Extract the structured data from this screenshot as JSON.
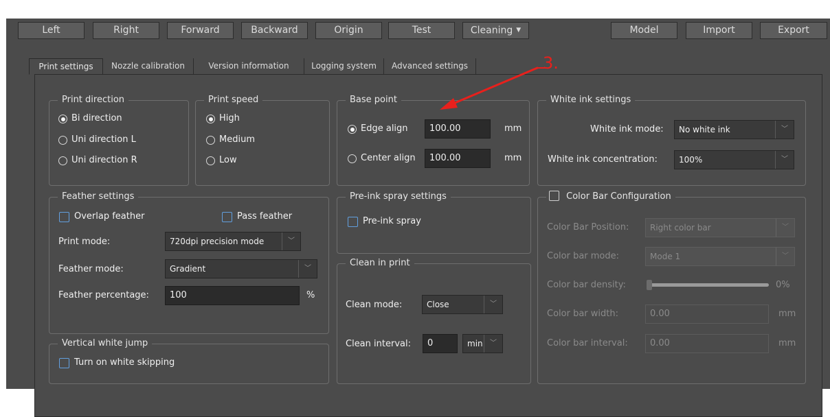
{
  "toolbar": {
    "left": "Left",
    "right": "Right",
    "forward": "Forward",
    "backward": "Backward",
    "origin": "Origin",
    "test": "Test",
    "cleaning": "Cleaning",
    "model": "Model",
    "import": "Import",
    "export": "Export"
  },
  "tabs": [
    "Print settings",
    "Nozzle calibration",
    "Version information",
    "Logging system",
    "Advanced settings"
  ],
  "annotation": {
    "text": "3.",
    "color": "#e8201c"
  },
  "print_direction": {
    "title": "Print direction",
    "options": [
      "Bi direction",
      "Uni direction L",
      "Uni direction R"
    ],
    "selected": "Bi direction"
  },
  "print_speed": {
    "title": "Print speed",
    "options": [
      "High",
      "Medium",
      "Low"
    ],
    "selected": "High"
  },
  "base_point": {
    "title": "Base point",
    "edge_label": "Edge align",
    "edge_value": "100.00",
    "edge_unit": "mm",
    "center_label": "Center align",
    "center_value": "100.00",
    "center_unit": "mm",
    "selected": "Edge align"
  },
  "white_ink": {
    "title": "White ink settings",
    "mode_label": "White ink mode:",
    "mode_value": "No white ink",
    "conc_label": "White ink concentration:",
    "conc_value": "100%"
  },
  "feather": {
    "title": "Feather settings",
    "overlap_label": "Overlap feather",
    "pass_label": "Pass feather",
    "print_mode_label": "Print mode:",
    "print_mode_value": "720dpi precision mode",
    "feather_mode_label": "Feather mode:",
    "feather_mode_value": "Gradient",
    "pct_label": "Feather percentage:",
    "pct_value": "100",
    "pct_unit": "%"
  },
  "pre_ink": {
    "title": "Pre-ink spray settings",
    "check_label": "Pre-ink spray"
  },
  "clean": {
    "title": "Clean in print",
    "mode_label": "Clean mode:",
    "mode_value": "Close",
    "interval_label": "Clean interval:",
    "interval_value": "0",
    "interval_unit": "min"
  },
  "color_bar": {
    "title": "Color Bar Configuration",
    "position_label": "Color Bar Position:",
    "position_value": "Right color bar",
    "mode_label": "Color bar mode:",
    "mode_value": "Mode 1",
    "density_label": "Color bar density:",
    "density_value": "0%",
    "density_level": 0,
    "width_label": "Color bar width:",
    "width_value": "0.00",
    "width_unit": "mm",
    "interval_label": "Color bar interval:",
    "interval_value": "0.00",
    "interval_unit": "mm"
  },
  "vertical_white": {
    "title": "Vertical white jump",
    "check_label": "Turn on white skipping"
  },
  "colors": {
    "accent_check": "#62a0e0",
    "panel_bg": "#4b4b4b",
    "annotation_red": "#e8201c"
  }
}
